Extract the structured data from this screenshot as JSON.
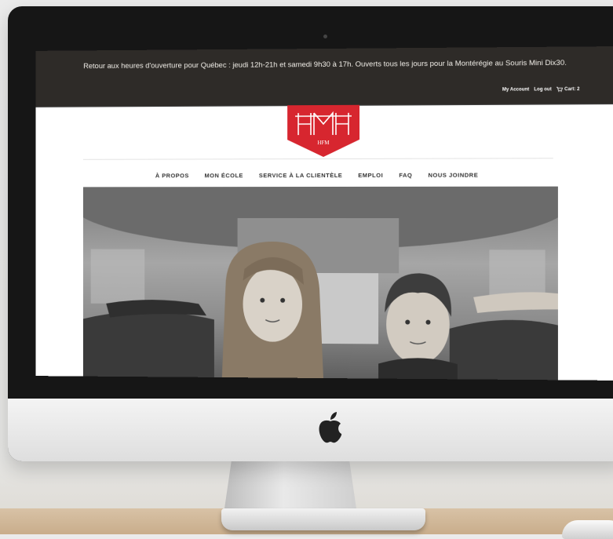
{
  "announcement": "Retour aux heures d'ouverture pour Québec : jeudi 12h-21h et samedi 9h30 à 17h. Ouverts tous les jours pour la Montérégie au Souris Mini Dix30.",
  "account": {
    "my_account": "My Account",
    "log_out": "Log out",
    "cart": "Cart: 2"
  },
  "logo": {
    "text": "HFM"
  },
  "nav": {
    "items": [
      "À PROPOS",
      "MON ÉCOLE",
      "SERVICE À LA CLIENTÈLE",
      "EMPLOI",
      "FAQ",
      "NOUS JOINDRE"
    ]
  },
  "hero": {
    "icon": "school-bus-children-photo"
  },
  "colors": {
    "brand_red": "#d7262f",
    "topbar": "#2e2b28"
  }
}
